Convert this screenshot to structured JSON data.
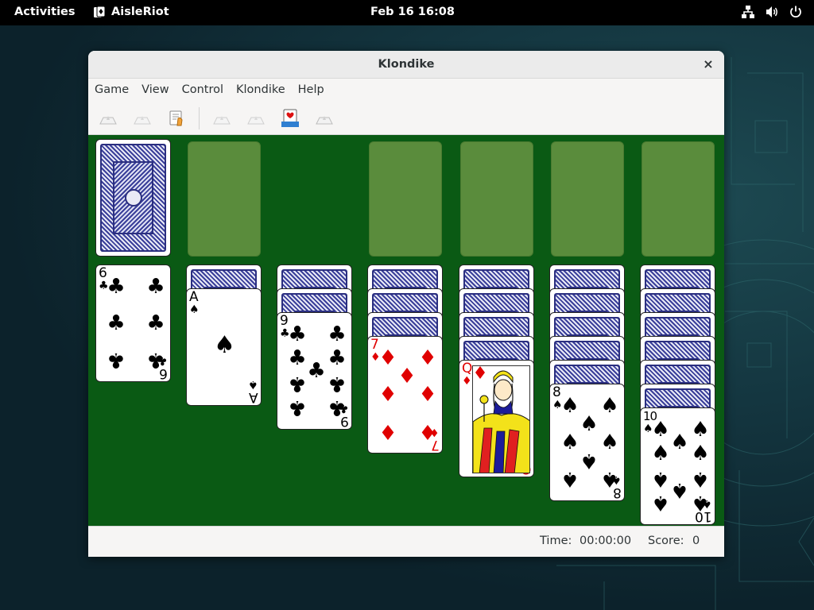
{
  "topbar": {
    "activities": "Activities",
    "app_name": "AisleRiot",
    "clock": "Feb 16  16:08",
    "tray_icons": [
      "network-icon",
      "volume-icon",
      "power-icon"
    ]
  },
  "window": {
    "title": "Klondike",
    "close_label": "×"
  },
  "menubar": {
    "items": [
      "Game",
      "View",
      "Control",
      "Klondike",
      "Help"
    ]
  },
  "toolbar": {
    "buttons": [
      "new-game",
      "restart",
      "hint",
      "undo",
      "redo",
      "deal",
      "leave-fullscreen"
    ]
  },
  "status": {
    "time_label": "Time:",
    "time_value": "00:00:00",
    "score_label": "Score:",
    "score_value": "0"
  },
  "tableau": [
    {
      "face_down": 0,
      "top": {
        "rank": "6",
        "suit": "♣",
        "color": "black"
      }
    },
    {
      "face_down": 1,
      "top": {
        "rank": "A",
        "suit": "♠",
        "color": "black"
      }
    },
    {
      "face_down": 2,
      "top": {
        "rank": "9",
        "suit": "♣",
        "color": "black"
      }
    },
    {
      "face_down": 3,
      "top": {
        "rank": "7",
        "suit": "♦",
        "color": "red"
      }
    },
    {
      "face_down": 4,
      "top": {
        "rank": "Q",
        "suit": "♦",
        "color": "red"
      }
    },
    {
      "face_down": 5,
      "top": {
        "rank": "8",
        "suit": "♠",
        "color": "black"
      }
    },
    {
      "face_down": 6,
      "top": {
        "rank": "10",
        "suit": "♠",
        "color": "black"
      }
    }
  ],
  "colors": {
    "felt": "#0a5a14",
    "slot": "#5a8c3c",
    "card_back": "#3a3f9a",
    "red_suit": "#e00000"
  }
}
